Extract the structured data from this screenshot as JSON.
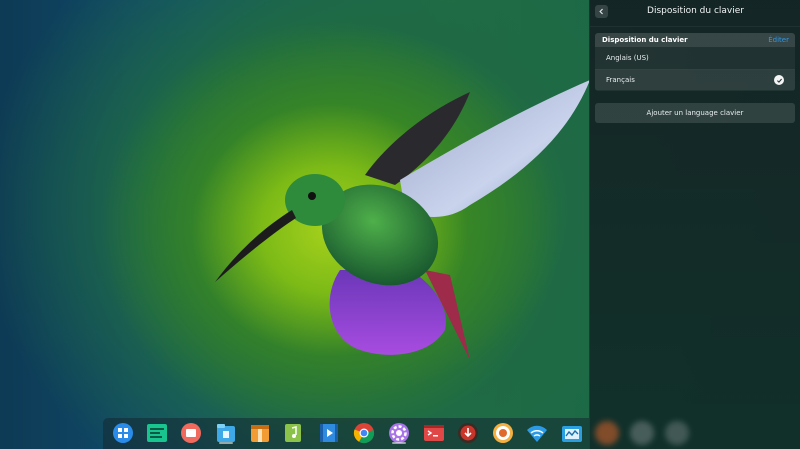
{
  "panel": {
    "title": "Disposition du clavier",
    "group_label": "Disposition du clavier",
    "edit_label": "Éditer",
    "layouts": [
      {
        "label": "Anglais (US)",
        "selected": false
      },
      {
        "label": "Français",
        "selected": true
      }
    ],
    "add_label": "Ajouter un language clavier"
  },
  "dock": {
    "items": [
      {
        "icon": "launcher-icon",
        "color": "#2a8ce8"
      },
      {
        "icon": "terminal-green-icon",
        "color": "#18c58f"
      },
      {
        "icon": "multitask-icon",
        "color": "#f06a5e"
      },
      {
        "icon": "file-manager-icon",
        "color": "#3fa8e6"
      },
      {
        "icon": "archive-manager-icon",
        "color": "#f39c33"
      },
      {
        "icon": "music-icon",
        "color": "#8bc34a"
      },
      {
        "icon": "movie-icon",
        "color": "#2e8be0"
      },
      {
        "icon": "chrome-icon",
        "color": "#4285f4"
      },
      {
        "icon": "settings-icon",
        "color": "#a974e8"
      },
      {
        "icon": "terminal-icon",
        "color": "#e04848"
      },
      {
        "icon": "app-store-icon",
        "color": "#c8352b"
      },
      {
        "icon": "software-icon",
        "color": "#f4b040"
      },
      {
        "icon": "wifi-icon",
        "color": "#2b9be8"
      },
      {
        "icon": "system-monitor-icon",
        "color": "#2aa0e0"
      }
    ]
  }
}
